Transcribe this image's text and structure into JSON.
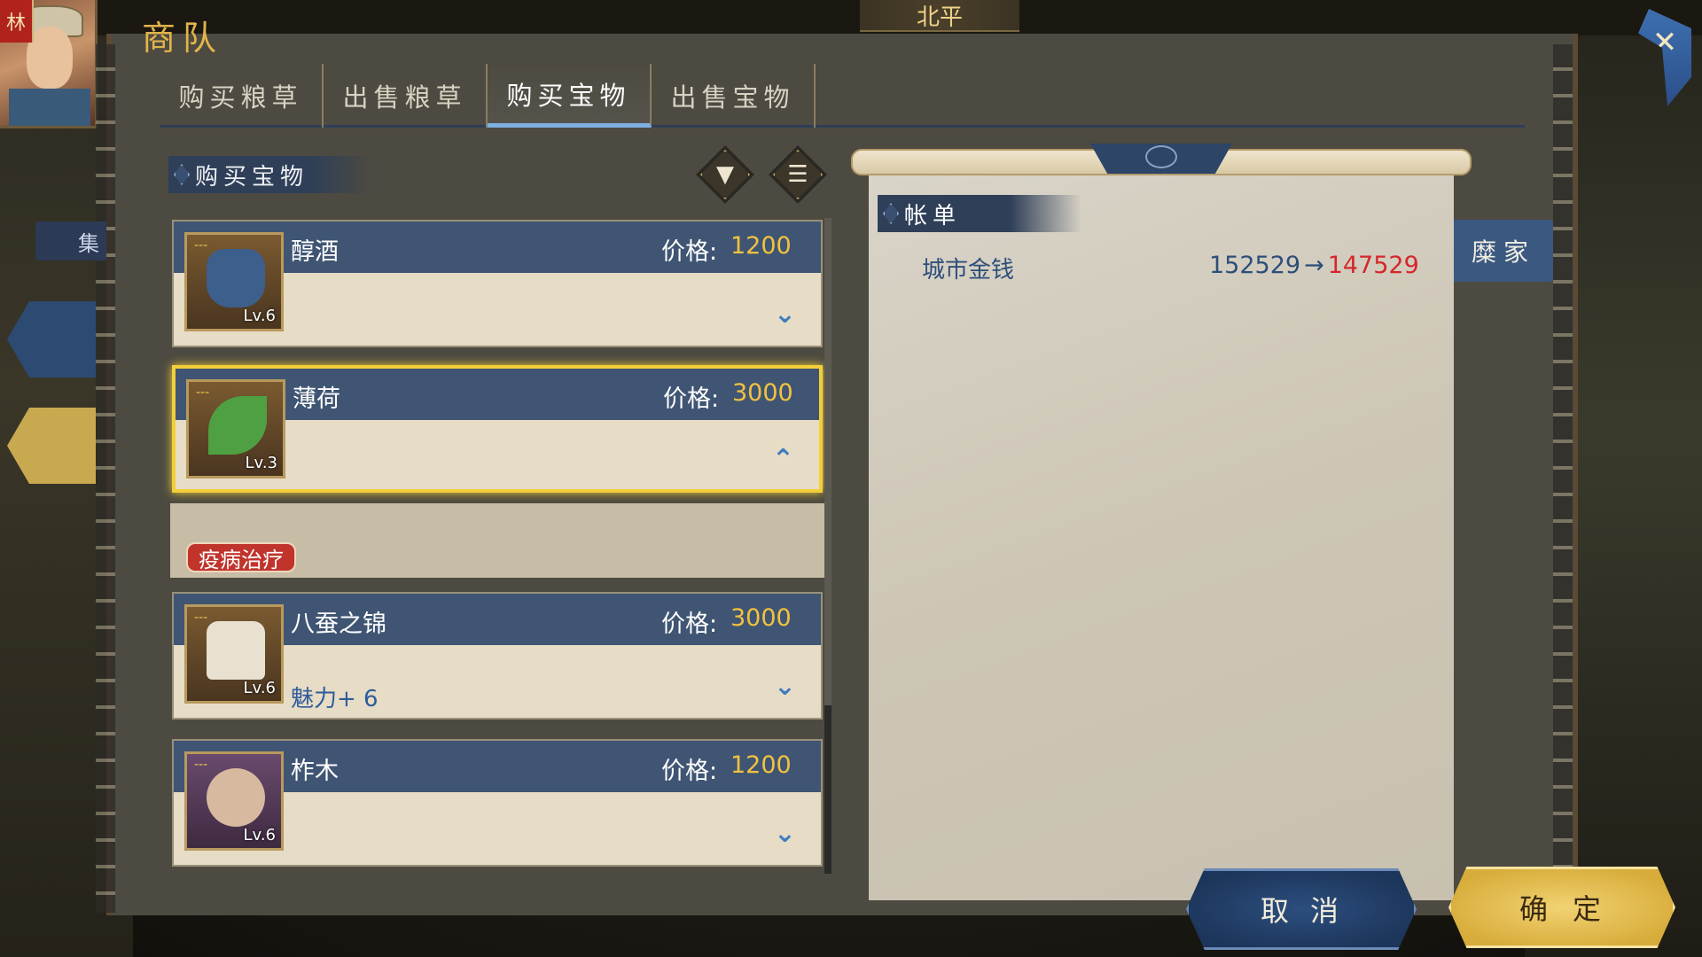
{
  "header": {
    "avatar_badge": "林",
    "city": "北平",
    "panel_title": "商队"
  },
  "side": {
    "tab_label": "集"
  },
  "tabs": [
    {
      "label": "购买粮草",
      "active": false
    },
    {
      "label": "出售粮草",
      "active": false
    },
    {
      "label": "购买宝物",
      "active": true
    },
    {
      "label": "出售宝物",
      "active": false
    }
  ],
  "list": {
    "header": "购买宝物",
    "price_label": "价格:",
    "items": [
      {
        "name": "醇酒",
        "price": "1200",
        "level": "Lv.6",
        "expanded": false,
        "attr": ""
      },
      {
        "name": "薄荷",
        "price": "3000",
        "level": "Lv.3",
        "expanded": true,
        "attr": "",
        "tag": "疫病治疗"
      },
      {
        "name": "八蚕之锦",
        "price": "3000",
        "level": "Lv.6",
        "expanded": false,
        "attr": "魅力+ 6"
      },
      {
        "name": "柞木",
        "price": "1200",
        "level": "Lv.6",
        "expanded": false,
        "attr": ""
      }
    ]
  },
  "bill": {
    "header": "帐单",
    "row_label": "城市金钱",
    "old_value": "152529",
    "arrow": "→",
    "new_value": "147529",
    "owner": "糜家"
  },
  "buttons": {
    "cancel": "取消",
    "confirm": "确定"
  },
  "colors": {
    "accent_gold": "#f3c23e",
    "header_blue": "#3f5573",
    "new_value_red": "#d6262a"
  }
}
